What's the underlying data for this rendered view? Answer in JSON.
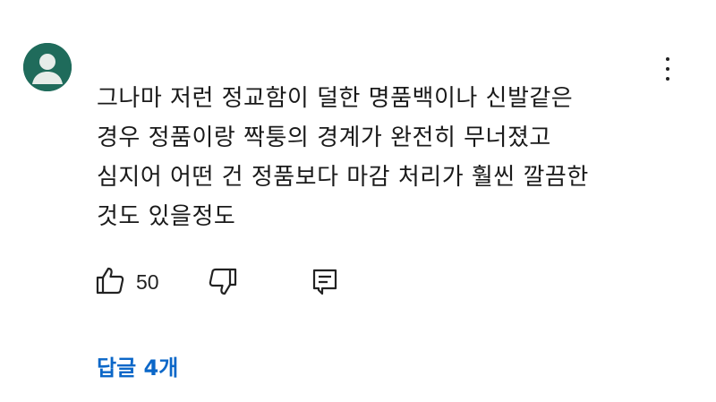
{
  "comment": {
    "text_lines": [
      "그나마 저런 정교함이 덜한 명품백이나 신발같은",
      "경우 정품이랑 짝퉁의 경계가 완전히 무너졌고",
      "심지어 어떤 건 정품보다 마감 처리가 훨씬 깔끔한",
      "것도 있을정도"
    ],
    "like_count": "50",
    "replies_label": "답글 4개"
  },
  "icons": {
    "avatar": "default-user-avatar",
    "menu": "more-vert-icon",
    "like": "thumb-up-icon",
    "dislike": "thumb-down-icon",
    "reply": "comment-reply-icon"
  },
  "colors": {
    "avatar_bg": "#1f6b5b",
    "text": "#1a1a1a",
    "link": "#0b67c8"
  }
}
